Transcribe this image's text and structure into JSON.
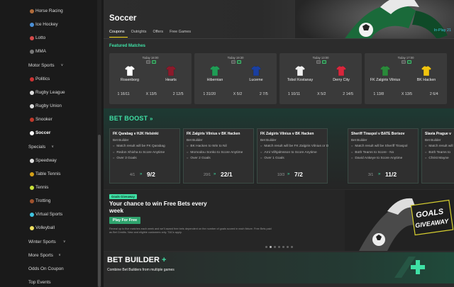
{
  "sidebar": {
    "items": [
      {
        "label": "Horse Racing",
        "icon": "horse-racing-icon",
        "color": "#b06b3a"
      },
      {
        "label": "Ice Hockey",
        "icon": "ice-hockey-icon",
        "color": "#4a8fd6"
      },
      {
        "label": "Lotto",
        "icon": "lotto-icon",
        "color": "#d64a4a"
      },
      {
        "label": "MMA",
        "icon": "mma-icon",
        "color": "#777777"
      },
      {
        "label": "Motor Sports",
        "icon": "",
        "chevron": true
      },
      {
        "label": "Politics",
        "icon": "politics-icon",
        "color": "#cc3333"
      },
      {
        "label": "Rugby League",
        "icon": "rugby-league-icon",
        "color": "#dddddd"
      },
      {
        "label": "Rugby Union",
        "icon": "rugby-union-icon",
        "color": "#dddddd"
      },
      {
        "label": "Snooker",
        "icon": "snooker-icon",
        "color": "#c0392b"
      },
      {
        "label": "Soccer",
        "icon": "soccer-icon",
        "color": "#ffffff",
        "active": true
      },
      {
        "label": "Specials",
        "icon": "",
        "chevron": true
      },
      {
        "label": "Speedway",
        "icon": "speedway-icon",
        "color": "#e0e0e0"
      },
      {
        "label": "Table Tennis",
        "icon": "table-tennis-icon",
        "color": "#d4a017"
      },
      {
        "label": "Tennis",
        "icon": "tennis-icon",
        "color": "#c9e23a"
      },
      {
        "label": "Trotting",
        "icon": "trotting-icon",
        "color": "#a0522d"
      },
      {
        "label": "Virtual Sports",
        "icon": "virtual-sports-icon",
        "color": "#3fc4e0"
      },
      {
        "label": "Volleyball",
        "icon": "volleyball-icon",
        "color": "#f0e060"
      },
      {
        "label": "Winter Sports",
        "icon": "",
        "chevron": true
      },
      {
        "label": "More Sports",
        "icon": "",
        "chevron": true
      },
      {
        "label": "Odds On Coupon",
        "icon": ""
      },
      {
        "label": "Top Events",
        "icon": ""
      }
    ]
  },
  "header": {
    "title": "Soccer",
    "tabs": [
      "Coupons",
      "Outrights",
      "Offers",
      "Free Games"
    ],
    "in_play": "In-Play 21"
  },
  "featured": {
    "title": "Featured Matches",
    "matches": [
      {
        "time": "Today 18:00",
        "home": "Rosenborg",
        "away": "Hearts",
        "odds": [
          "1 16/11",
          "X 13/5",
          "2 12/5"
        ],
        "home_color": "#ffffff",
        "away_color": "#8b1a2b"
      },
      {
        "time": "Today 19:30",
        "home": "Hibernian",
        "away": "Lucerne",
        "odds": [
          "1 31/20",
          "X 5/2",
          "2 7/5"
        ],
        "home_color": "#1f9d55",
        "away_color": "#1a3fa0"
      },
      {
        "time": "Today 13:00",
        "home": "Tobol Kostanay",
        "away": "Derry City",
        "odds": [
          "1 10/11",
          "X 5/2",
          "2 14/5"
        ],
        "home_color": "#f0f0f0",
        "away_color": "#d8263c"
      },
      {
        "time": "Today 17:00",
        "home": "FK Zalgiris Vilnius",
        "away": "BK Hacken",
        "odds": [
          "1 13/8",
          "X 13/5",
          "2 6/4"
        ],
        "home_color": "#2a8a3a",
        "away_color": "#f1c40f"
      }
    ]
  },
  "bet_boost": {
    "title": "BET BOOST",
    "cards": [
      {
        "title": "FK Qarabag v HJK Helsinki",
        "sub": "Bet Builder",
        "legs": [
          "Match result will be FK Qarabag",
          "Redon Xhixha to Score Anytime",
          "Over 3 Goals"
        ],
        "old": "4/1",
        "new": "9/2"
      },
      {
        "title": "FK Zalgiris Vilnius v BK Hacken",
        "sub": "Bet Builder",
        "legs": [
          "BK Hacken to Win to Nil",
          "Momodou Sonko to Score Anytime",
          "Over 2 Goals"
        ],
        "old": "20/1",
        "new": "22/1"
      },
      {
        "title": "FK Zalgiris Vilnius v BK Hacken",
        "sub": "Bet Builder",
        "legs": [
          "Match result will be FK Zalgiris Vilnius or Draw",
          "Arni Vilhjalmsson to Score Anytime",
          "Over 1 Goals"
        ],
        "old": "10/3",
        "new": "7/2"
      },
      {
        "title": "Sheriff Tiraspol v BATE Borisov",
        "sub": "Bet Builder",
        "legs": [
          "Match result will be Sheriff Tiraspol",
          "Both Teams to Score - No",
          "David Ankeye to Score Anytime"
        ],
        "old": "3/1",
        "new": "11/2"
      },
      {
        "title": "Slavia Prague v",
        "sub": "Bet Builder",
        "legs": [
          "Match result will",
          "Both Teams to",
          "Christ Mayne"
        ],
        "old": "",
        "new": ""
      }
    ]
  },
  "promo": {
    "badge": "Goals Giveaway",
    "headline": "Your chance to win Free Bets every week",
    "button": "Play For Free",
    "text": "Reveal up to five matches each week and we'll award free bets dependent on the number of goals scored in each fixture. Free Bets paid as Bet Credits. New and eligible customers only. T&Cs apply.",
    "art_text": [
      "GOALS",
      "GIVEAWAY"
    ]
  },
  "carousel": {
    "count": 7,
    "active": 1
  },
  "bet_builder": {
    "title": "BET BUILDER",
    "plus": "+",
    "subtitle": "Combine Bet Builders from multiple games"
  },
  "colors": {
    "accent": "#3fe0a5",
    "tab_underline": "#ffdf1b",
    "in_play": "#3fc4e0"
  }
}
